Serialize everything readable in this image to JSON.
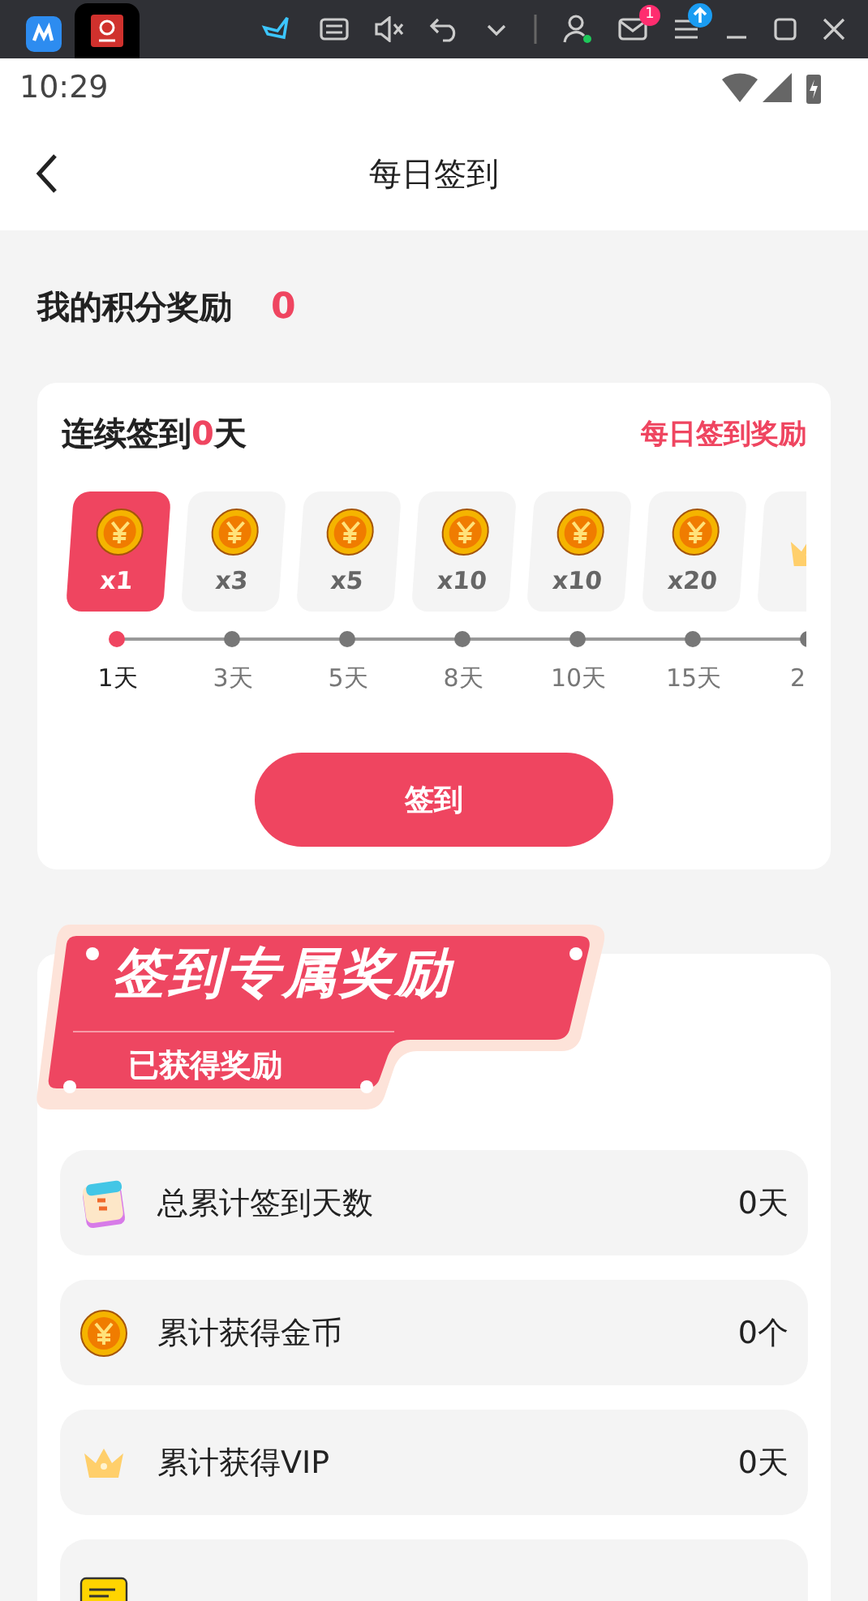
{
  "app_bar": {
    "badge": "1"
  },
  "status_bar": {
    "time": "10:29"
  },
  "header": {
    "title": "每日签到"
  },
  "points": {
    "label": "我的积分奖励",
    "value": "0"
  },
  "checkin": {
    "title_prefix": "连续签到",
    "count": "0",
    "title_suffix": "天",
    "link": "每日签到奖励",
    "button": "签到",
    "rewards": [
      {
        "kind": "coin",
        "amount": "x1",
        "day": "1天",
        "selected": true
      },
      {
        "kind": "coin",
        "amount": "x3",
        "day": "3天",
        "selected": false
      },
      {
        "kind": "coin",
        "amount": "x5",
        "day": "5天",
        "selected": false
      },
      {
        "kind": "coin",
        "amount": "x10",
        "day": "8天",
        "selected": false
      },
      {
        "kind": "coin",
        "amount": "x10",
        "day": "10天",
        "selected": false
      },
      {
        "kind": "coin",
        "amount": "x20",
        "day": "15天",
        "selected": false
      },
      {
        "kind": "crown",
        "day": "2",
        "selected": false
      }
    ]
  },
  "exclusive": {
    "banner_title": "签到专属奖励",
    "banner_subtitle": "已获得奖励",
    "stats": [
      {
        "kind": "calendar",
        "label": "总累计签到天数",
        "value": "0天"
      },
      {
        "kind": "coin",
        "label": "累计获得金币",
        "value": "0个"
      },
      {
        "kind": "crown",
        "label": "累计获得VIP",
        "value": "0天"
      },
      {
        "kind": "ticket"
      }
    ]
  }
}
